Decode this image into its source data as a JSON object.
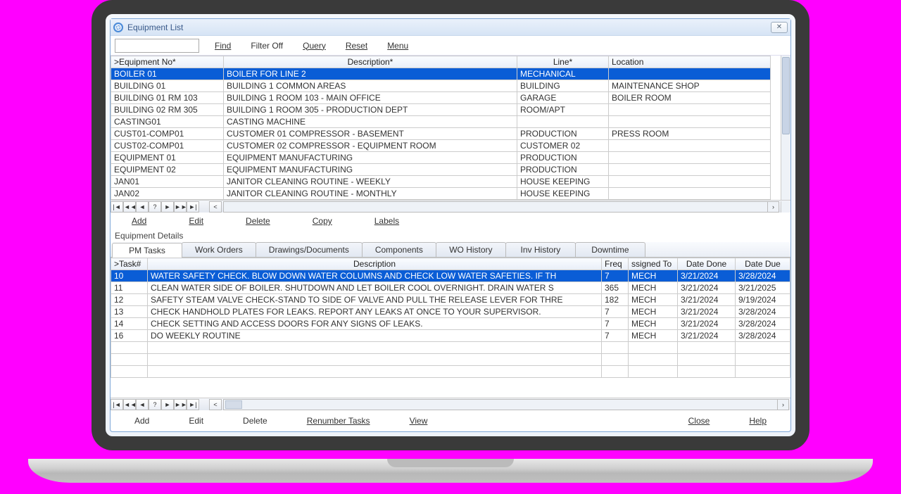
{
  "window": {
    "title": "Equipment List"
  },
  "menu": {
    "find": "Find",
    "filter_off": "Filter Off",
    "query": "Query",
    "reset": "Reset",
    "menu": "Menu"
  },
  "equip_headers": {
    "no": ">Equipment No*",
    "desc": "Description*",
    "line": "Line*",
    "loc": "Location"
  },
  "equipment": [
    {
      "no": "BOILER 01",
      "desc": "BOILER FOR LINE 2",
      "line": "MECHANICAL",
      "loc": "",
      "sel": true
    },
    {
      "no": "BUILDING 01",
      "desc": "BUILDING 1 COMMON AREAS",
      "line": "BUILDING",
      "loc": "MAINTENANCE SHOP"
    },
    {
      "no": "BUILDING 01 RM 103",
      "desc": "BUILDING 1 ROOM 103 - MAIN OFFICE",
      "line": "GARAGE",
      "loc": "BOILER ROOM"
    },
    {
      "no": "BUILDING 02 RM 305",
      "desc": "BUILDING 1 ROOM 305 - PRODUCTION DEPT",
      "line": "ROOM/APT",
      "loc": ""
    },
    {
      "no": "CASTING01",
      "desc": "CASTING MACHINE",
      "line": "",
      "loc": ""
    },
    {
      "no": "CUST01-COMP01",
      "desc": "CUSTOMER 01 COMPRESSOR - BASEMENT",
      "line": "PRODUCTION",
      "loc": "PRESS ROOM"
    },
    {
      "no": "CUST02-COMP01",
      "desc": "CUSTOMER 02 COMPRESSOR - EQUIPMENT ROOM",
      "line": "CUSTOMER 02",
      "loc": ""
    },
    {
      "no": "EQUIPMENT 01",
      "desc": "EQUIPMENT MANUFACTURING",
      "line": "PRODUCTION",
      "loc": ""
    },
    {
      "no": "EQUIPMENT 02",
      "desc": "EQUIPMENT MANUFACTURING",
      "line": "PRODUCTION",
      "loc": ""
    },
    {
      "no": "JAN01",
      "desc": "JANITOR CLEANING ROUTINE - WEEKLY",
      "line": "HOUSE KEEPING",
      "loc": ""
    },
    {
      "no": "JAN02",
      "desc": "JANITOR CLEANING ROUTINE - MONTHLY",
      "line": "HOUSE KEEPING",
      "loc": ""
    }
  ],
  "actions1": {
    "add": "Add",
    "edit": "Edit",
    "delete": "Delete",
    "copy": "Copy",
    "labels": "Labels"
  },
  "details_label": "Equipment Details",
  "tabs": {
    "pm": "PM Tasks",
    "wo": "Work Orders",
    "draw": "Drawings/Documents",
    "comp": "Components",
    "woh": "WO History",
    "invh": "Inv History",
    "down": "Downtime"
  },
  "task_headers": {
    "task": ">Task#",
    "desc": "Description",
    "freq": "Freq",
    "assigned": "ssigned To",
    "done": "Date Done",
    "due": "Date Due"
  },
  "tasks": [
    {
      "task": "10",
      "desc": "WATER SAFETY CHECK. BLOW DOWN WATER COLUMNS AND CHECK LOW WATER SAFETIES. IF TH",
      "freq": "7",
      "assigned": "MECH",
      "done": "3/21/2024",
      "due": "3/28/2024",
      "sel": true
    },
    {
      "task": "11",
      "desc": "CLEAN WATER SIDE OF BOILER.  SHUTDOWN AND LET BOILER COOL OVERNIGHT. DRAIN WATER S",
      "freq": "365",
      "assigned": "MECH",
      "done": "3/21/2024",
      "due": "3/21/2025"
    },
    {
      "task": "12",
      "desc": "SAFETY STEAM VALVE CHECK-STAND TO SIDE OF VALVE AND PULL THE RELEASE LEVER FOR THRE",
      "freq": "182",
      "assigned": "MECH",
      "done": "3/21/2024",
      "due": "9/19/2024"
    },
    {
      "task": "13",
      "desc": "CHECK HANDHOLD PLATES FOR LEAKS. REPORT ANY LEAKS AT ONCE TO YOUR SUPERVISOR.",
      "freq": "7",
      "assigned": "MECH",
      "done": "3/21/2024",
      "due": "3/28/2024"
    },
    {
      "task": "14",
      "desc": "CHECK SETTING AND ACCESS DOORS FOR ANY SIGNS OF LEAKS.",
      "freq": "7",
      "assigned": "MECH",
      "done": "3/21/2024",
      "due": "3/28/2024"
    },
    {
      "task": "16",
      "desc": "DO WEEKLY ROUTINE",
      "freq": "7",
      "assigned": "MECH",
      "done": "3/21/2024",
      "due": "3/28/2024"
    }
  ],
  "actions2": {
    "add": "Add",
    "edit": "Edit",
    "delete": "Delete",
    "renumber": "Renumber Tasks",
    "view": "View"
  },
  "footer": {
    "close": "Close",
    "help": "Help"
  },
  "nav": {
    "first": "|◄",
    "fastprev": "◄◄",
    "prev": "◄",
    "help": "?",
    "next": "►",
    "fastnext": "►►",
    "last": "►|",
    "lsep": "<"
  }
}
